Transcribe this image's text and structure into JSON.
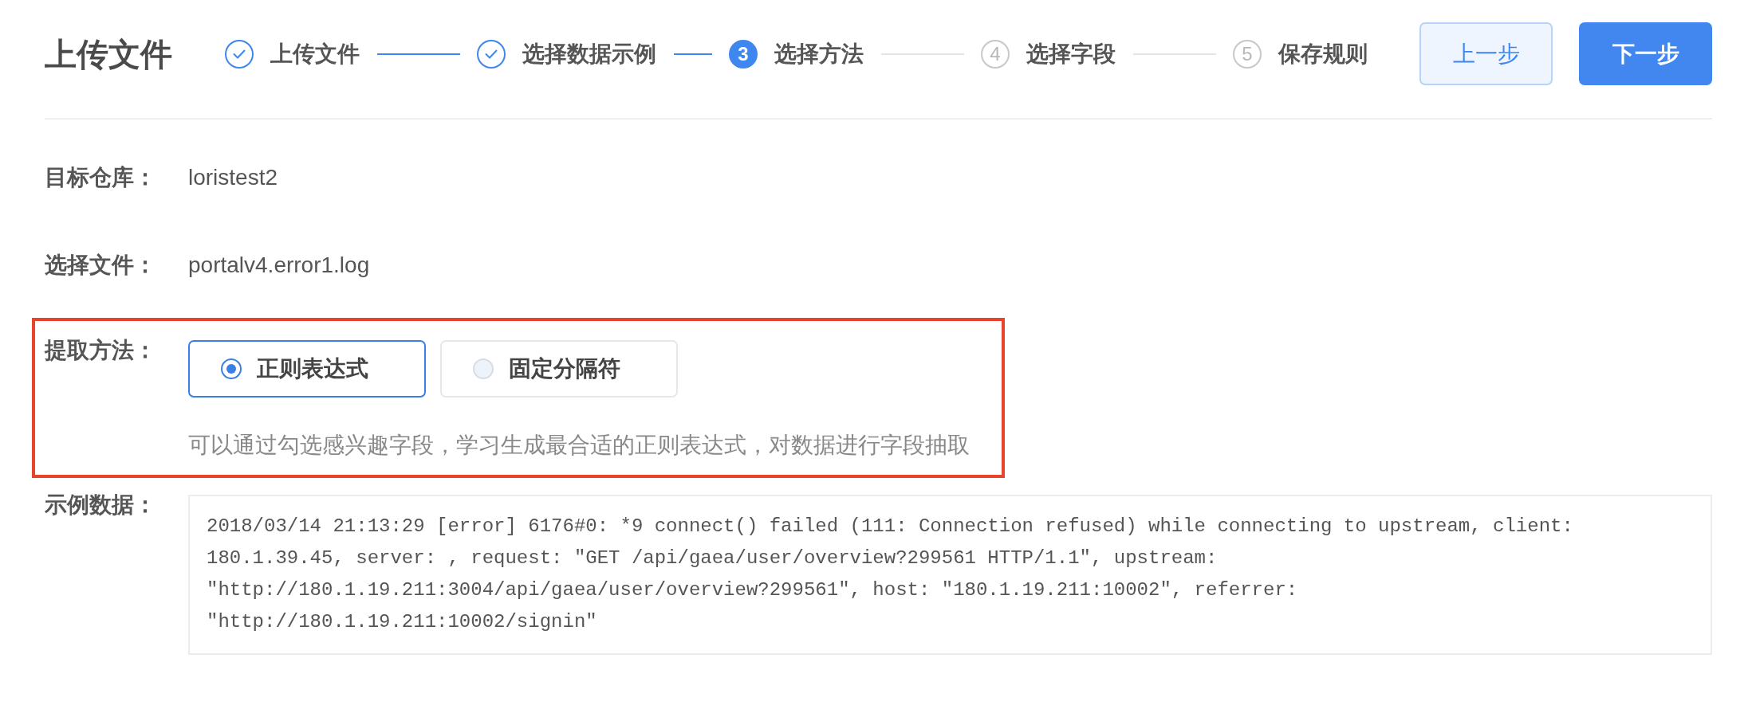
{
  "header": {
    "title": "上传文件",
    "steps": [
      {
        "kind": "finished",
        "label": "上传文件"
      },
      {
        "kind": "finished",
        "label": "选择数据示例"
      },
      {
        "kind": "current",
        "number": "3",
        "label": "选择方法"
      },
      {
        "kind": "waiting",
        "number": "4",
        "label": "选择字段"
      },
      {
        "kind": "waiting",
        "number": "5",
        "label": "保存规则"
      }
    ],
    "buttons": [
      {
        "label": "上一步",
        "kind": "secondary"
      },
      {
        "label": "下一步",
        "kind": "primary"
      }
    ]
  },
  "form": {
    "fields": [
      {
        "label": "目标仓库：",
        "value": "loristest2"
      },
      {
        "label": "选择文件：",
        "value": "portalv4.error1.log"
      }
    ],
    "extract_method": {
      "label": "提取方法：",
      "highlighted": true,
      "options": [
        {
          "label": "正则表达式",
          "selected": true
        },
        {
          "label": "固定分隔符",
          "selected": false
        }
      ],
      "hint": "可以通过勾选感兴趣字段，学习生成最合适的正则表达式，对数据进行字段抽取"
    },
    "sample_data": {
      "label": "示例数据：",
      "lines": [
        "2018/03/14 21:13:29 [error] 6176#0: *9 connect() failed (111: Connection refused) while connecting to upstream, client:",
        "180.1.39.45, server: , request: \"GET /api/gaea/user/overview?299561 HTTP/1.1\", upstream:",
        "\"http://180.1.19.211:3004/api/gaea/user/overview?299561\", host: \"180.1.19.211:10002\", referrer:",
        "\"http://180.1.19.211:10002/signin\""
      ]
    }
  }
}
